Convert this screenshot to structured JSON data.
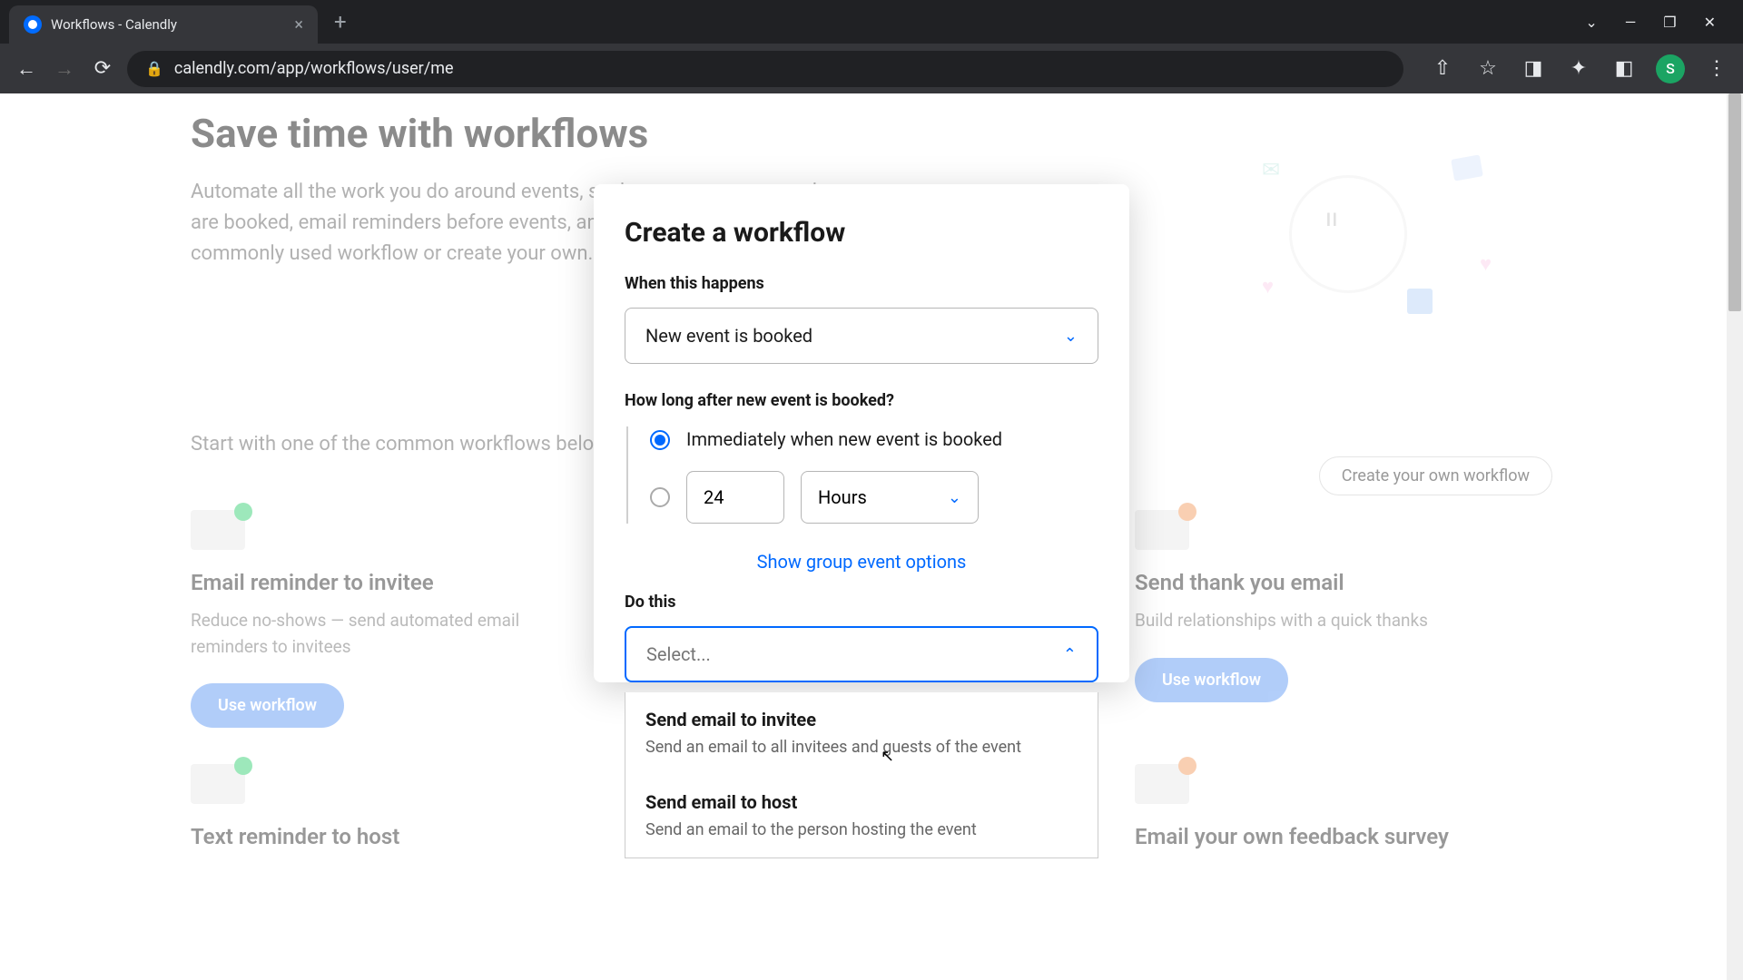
{
  "browser": {
    "tab_title": "Workflows - Calendly",
    "url": "calendly.com/app/workflows/user/me",
    "avatar_initial": "S"
  },
  "page": {
    "title": "Save time with workflows",
    "description": "Automate all the work you do around events, such as text messages when events are booked, email reminders before events, and more. You can start with a commonly used workflow or create your own.",
    "section_label": "Start with one of the common workflows below",
    "create_button": "Create your own workflow",
    "cards": [
      {
        "title": "Email reminder to invitee",
        "desc": "Reduce no-shows — send automated email reminders to invitees",
        "button": "Use workflow"
      },
      {
        "title": "Send thank you email",
        "desc": "Build relationships with a quick thanks",
        "button": "Use workflow"
      },
      {
        "title": "Text reminder to host",
        "desc": ""
      },
      {
        "title": "Email your own feedback survey",
        "desc": ""
      }
    ]
  },
  "modal": {
    "title": "Create a workflow",
    "trigger_label": "When this happens",
    "trigger_value": "New event is booked",
    "timing_label": "How long after new event is booked?",
    "radio_immediate": "Immediately when new event is booked",
    "delay_value": "24",
    "delay_unit": "Hours",
    "group_link": "Show group event options",
    "action_label": "Do this",
    "action_placeholder": "Select...",
    "dropdown_options": [
      {
        "title": "Send email to invitee",
        "desc": "Send an email to all invitees and guests of the event"
      },
      {
        "title": "Send email to host",
        "desc": "Send an email to the person hosting the event"
      }
    ]
  }
}
